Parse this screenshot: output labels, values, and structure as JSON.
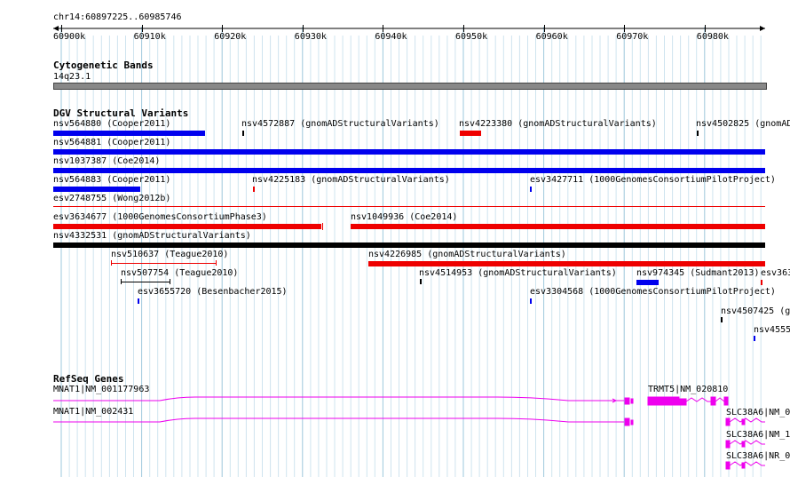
{
  "ruler": {
    "position_label": "chr14:60897225..60985746",
    "ticks": [
      "60900k",
      "60910k",
      "60920k",
      "60930k",
      "60940k",
      "60950k",
      "60960k",
      "60970k",
      "60980k"
    ]
  },
  "cytoband": {
    "title": "Cytogenetic Bands",
    "band_label": "14q23.1"
  },
  "dgv": {
    "title": "DGV Structural Variants",
    "features": [
      {
        "label": "nsv564880 (Cooper2011)",
        "color": "#0000ee"
      },
      {
        "label": "nsv4572887 (gnomADStructuralVariants)",
        "color": "#000000"
      },
      {
        "label": "nsv4223380 (gnomADStructuralVariants)",
        "color": "#ee0000"
      },
      {
        "label": "nsv4502825 (gnomAD",
        "color": "#000000"
      },
      {
        "label": "nsv564881 (Cooper2011)",
        "color": "#0000ee"
      },
      {
        "label": "nsv1037387 (Coe2014)",
        "color": "#0000ee"
      },
      {
        "label": "nsv564883 (Cooper2011)",
        "color": "#0000ee"
      },
      {
        "label": "nsv4225183 (gnomADStructuralVariants)",
        "color": "#ee0000"
      },
      {
        "label": "esv3427711 (1000GenomesConsortiumPilotProject)",
        "color": "#0000ee"
      },
      {
        "label": "esv2748755 (Wong2012b)",
        "color": "#ee0000"
      },
      {
        "label": "esv3634677 (1000GenomesConsortiumPhase3)",
        "color": "#ee0000"
      },
      {
        "label": "nsv1049936 (Coe2014)",
        "color": "#ee0000"
      },
      {
        "label": "nsv4332531 (gnomADStructuralVariants)",
        "color": "#000000"
      },
      {
        "label": "nsv510637 (Teague2010)",
        "color": "#ee0000"
      },
      {
        "label": "nsv4226985 (gnomADStructuralVariants)",
        "color": "#ee0000"
      },
      {
        "label": "nsv507754 (Teague2010)",
        "color": "#000000"
      },
      {
        "label": "nsv4514953 (gnomADStructuralVariants)",
        "color": "#000000"
      },
      {
        "label": "nsv974345 (Sudmant2013)",
        "color": "#0000ee"
      },
      {
        "label": "esv363",
        "color": "#ee0000"
      },
      {
        "label": "esv3655720 (Besenbacher2015)",
        "color": "#0000ee"
      },
      {
        "label": "esv3304568 (1000GenomesConsortiumPilotProject)",
        "color": "#0000ee"
      },
      {
        "label": "nsv4507425 (g",
        "color": "#000000"
      },
      {
        "label": "nsv4555",
        "color": "#0000ee"
      }
    ]
  },
  "refseq": {
    "title": "RefSeq Genes",
    "gene_color": "#ee00ee",
    "genes": [
      {
        "label": "MNAT1|NM_001177963"
      },
      {
        "label": "TRMT5|NM_020810"
      },
      {
        "label": "MNAT1|NM_002431"
      },
      {
        "label": "SLC38A6|NM_0"
      },
      {
        "label": "SLC38A6|NM_1"
      },
      {
        "label": "SLC38A6|NR_0"
      }
    ]
  }
}
